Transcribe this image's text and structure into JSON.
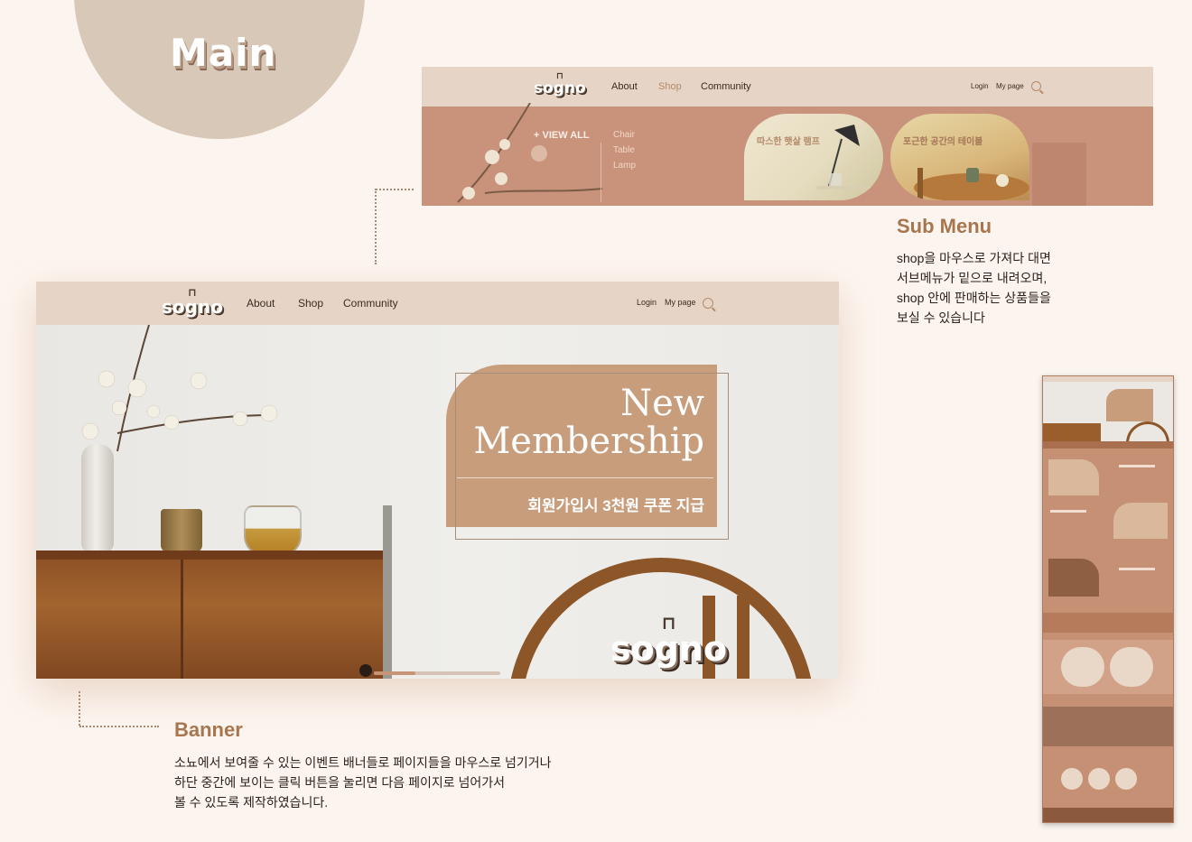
{
  "section_title": "Main",
  "brand": {
    "chair_glyph": "⊓",
    "logo_text": "sogno"
  },
  "nav": {
    "about": "About",
    "shop": "Shop",
    "community": "Community",
    "login": "Login",
    "mypage": "My page"
  },
  "submenu": {
    "view_all": "+ VIEW ALL",
    "categories": [
      "Chair",
      "Table",
      "Lamp"
    ],
    "cards": [
      {
        "label": "따스한 햇살 램프"
      },
      {
        "label": "포근한 공간의 테이블"
      }
    ],
    "heading": "Sub Menu",
    "description": [
      "shop을 마우스로 가져다 대면",
      "서브메뉴가 밑으로 내려오며,",
      "shop 안에 판매하는 상품들을",
      "보실 수 있습니다"
    ]
  },
  "banner": {
    "title_line1": "New",
    "title_line2": "Membership",
    "subtitle": "회원가입시 3천원 쿠폰 지급",
    "heading": "Banner",
    "description": [
      "소뇨에서 보여줄 수 있는 이벤트 배너들로 페이지들을 마우스로 넘기거나",
      "하단 중간에 보이는 클릭 버튼을 눌리면 다음 페이지로 넘어가서",
      "볼 수 있도록 제작하였습니다."
    ]
  },
  "colors": {
    "background": "#fcf5ef",
    "nav_bg": "#e6d5c6",
    "accent": "#c89d7c",
    "heading": "#a7764f",
    "submenu_bg": "#c8927b"
  }
}
